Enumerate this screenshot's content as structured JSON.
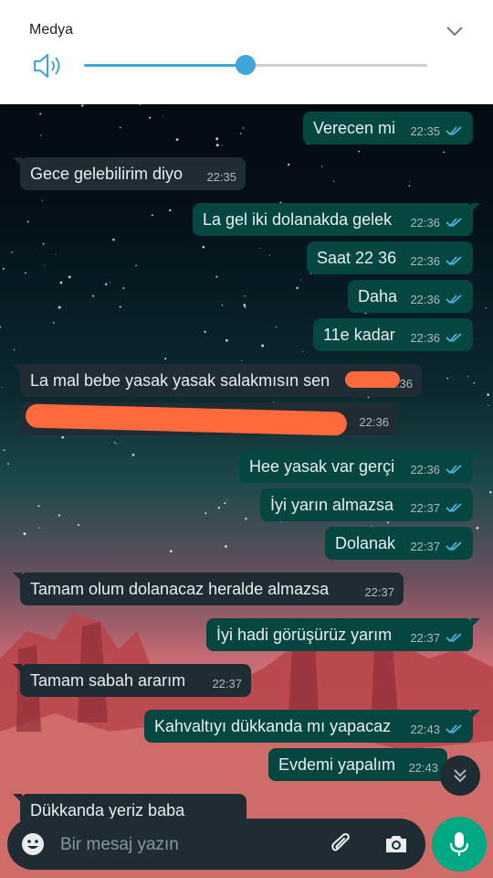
{
  "media_panel": {
    "title": "Medya",
    "volume_fraction": 0.47
  },
  "messages": [
    {
      "type": "out",
      "text": "Verecen mi",
      "time": "22:35"
    },
    {
      "type": "in",
      "text": "Gece gelebilirim diyo",
      "time": "22:35"
    },
    {
      "type": "out",
      "text": "La gel iki dolanakda gelek",
      "time": "22:36"
    },
    {
      "type": "out",
      "text": "Saat 22 36",
      "time": "22:36"
    },
    {
      "type": "out",
      "text": "Daha",
      "time": "22:36"
    },
    {
      "type": "out",
      "text": "11e kadar",
      "time": "22:36"
    },
    {
      "type": "in",
      "text": "La mal bebe yasak yasak salakmısın sen",
      "time": "22:36"
    },
    {
      "type": "in",
      "text": "",
      "time": "22:36"
    },
    {
      "type": "out",
      "text": "Hee yasak var gerçi",
      "time": "22:36"
    },
    {
      "type": "out",
      "text": "İyi yarın almazsa",
      "time": "22:37"
    },
    {
      "type": "out",
      "text": "Dolanak",
      "time": "22:37"
    },
    {
      "type": "in",
      "text": "Tamam olum dolanacaz heralde almazsa",
      "time": "22:37"
    },
    {
      "type": "out",
      "text": "İyi hadi görüşürüz yarım",
      "time": "22:37"
    },
    {
      "type": "in",
      "text": "Tamam sabah ararım",
      "time": "22:37"
    },
    {
      "type": "out",
      "text": "Kahvaltıyı dükkanda mı yapacaz",
      "time": "22:43"
    },
    {
      "type": "out",
      "text": "Evdemi yapalım",
      "time": "22:43"
    },
    {
      "type": "in",
      "text": "Dükkanda yeriz baba",
      "time": ""
    }
  ],
  "composer": {
    "placeholder": "Bir mesaj yazın"
  },
  "icons": {
    "emoji": "emoji-icon",
    "attach": "paperclip-icon",
    "camera": "camera-icon",
    "mic": "mic-icon",
    "scroll": "double-chevron-down-icon",
    "volume": "speaker-icon",
    "collapse": "chevron-down-icon"
  },
  "colors": {
    "outgoing_bubble": "#054740",
    "incoming_bubble": "#1f2c34",
    "read_ticks": "#53bdeb",
    "accent": "#00a884",
    "slider": "#3ea6d8"
  }
}
